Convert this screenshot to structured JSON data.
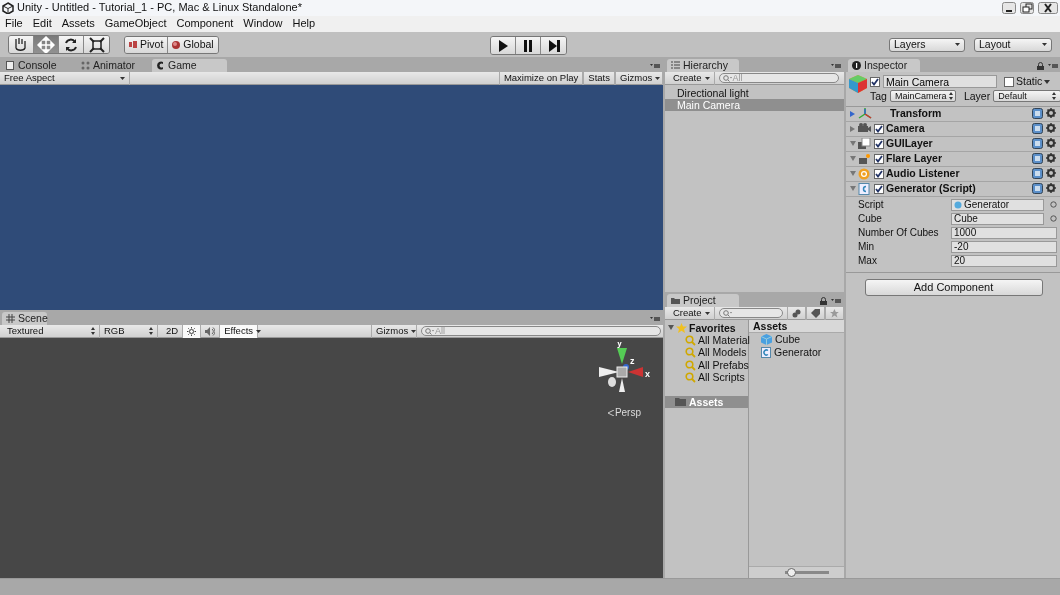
{
  "window": {
    "title": "Unity - Untitled - Tutorial_1 - PC, Mac & Linux Standalone*"
  },
  "menu": [
    "File",
    "Edit",
    "Assets",
    "GameObject",
    "Component",
    "Window",
    "Help"
  ],
  "toolbar": {
    "tools": [
      {
        "kind": "hand",
        "selected": false
      },
      {
        "kind": "move",
        "selected": true
      },
      {
        "kind": "rotate",
        "selected": false
      },
      {
        "kind": "scale",
        "selected": false
      }
    ],
    "pivot": "Pivot",
    "global": "Global",
    "layers": "Layers",
    "layout": "Layout"
  },
  "game_panel": {
    "tabs": [
      {
        "kind": "console",
        "label": "Console",
        "selected": false
      },
      {
        "kind": "animator",
        "label": "Animator",
        "selected": false
      },
      {
        "kind": "game",
        "label": "Game",
        "selected": true
      }
    ],
    "aspect": "Free Aspect",
    "buttons": [
      "Maximize on Play",
      "Stats",
      "Gizmos"
    ]
  },
  "scene_panel": {
    "tab": "Scene",
    "shading": "Textured",
    "render_mode": "RGB",
    "mode_2d": "2D",
    "lighting": true,
    "audio": false,
    "effects": "Effects",
    "gizmos": "Gizmos",
    "search_placeholder": "All",
    "axes": [
      "y",
      "z",
      "x"
    ],
    "projection": "Persp"
  },
  "hierarchy": {
    "tab": "Hierarchy",
    "create": "Create",
    "search_placeholder": "All",
    "items": [
      {
        "label": "Directional light",
        "selected": false
      },
      {
        "label": "Main Camera",
        "selected": true
      }
    ]
  },
  "project": {
    "tab": "Project",
    "create": "Create",
    "favorites": {
      "label": "Favorites",
      "expanded": true,
      "children": [
        {
          "label": "All Material"
        },
        {
          "label": "All Models"
        },
        {
          "label": "All Prefabs"
        },
        {
          "label": "All Scripts"
        }
      ]
    },
    "folders": [
      {
        "label": "Assets",
        "selected": true
      }
    ],
    "assets_header": "Assets",
    "assets": [
      {
        "kind": "model",
        "label": "Cube"
      },
      {
        "kind": "script",
        "label": "Generator"
      }
    ],
    "zoom_slider": {
      "level": 0.05
    }
  },
  "inspector": {
    "tab": "Inspector",
    "active": true,
    "object_name": "Main Camera",
    "static": false,
    "static_label": "Static",
    "tag_label": "Tag",
    "tag": "MainCamera",
    "layer_label": "Layer",
    "layer": "Default",
    "components": [
      {
        "kind": "transform",
        "name": "Transform",
        "expanded": false
      },
      {
        "kind": "camera",
        "name": "Camera",
        "expanded": false,
        "enabled": true
      },
      {
        "kind": "gui",
        "name": "GUILayer",
        "expanded": true,
        "enabled": true
      },
      {
        "kind": "flare",
        "name": "Flare Layer",
        "expanded": true,
        "enabled": true
      },
      {
        "kind": "audio",
        "name": "Audio Listener",
        "expanded": true,
        "enabled": true
      },
      {
        "kind": "script",
        "name": "Generator (Script)",
        "expanded": true,
        "enabled": true
      }
    ],
    "fields": [
      {
        "label": "Script",
        "value": "Generator",
        "kind": "script_ref"
      },
      {
        "label": "Cube",
        "value": "Cube",
        "kind": "object_ref"
      },
      {
        "label": "Number Of Cubes",
        "value": "1000",
        "kind": "number"
      },
      {
        "label": "Min",
        "value": "-20",
        "kind": "number"
      },
      {
        "label": "Max",
        "value": "20",
        "kind": "number"
      }
    ],
    "add_component": "Add Component"
  }
}
